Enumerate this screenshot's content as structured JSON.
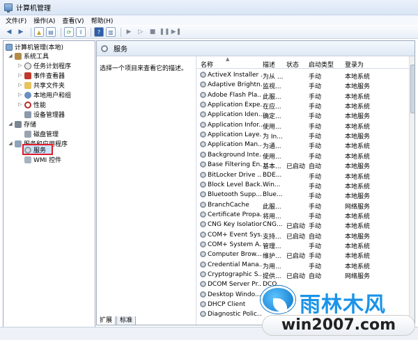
{
  "window": {
    "title": "计算机管理"
  },
  "menu": [
    "文件(F)",
    "操作(A)",
    "查看(V)",
    "帮助(H)"
  ],
  "tree": {
    "root": "计算机管理(本地)",
    "system_tools": "系统工具",
    "task_scheduler": "任务计划程序",
    "event_viewer": "事件查看器",
    "shared_folders": "共享文件夹",
    "local_users": "本地用户和组",
    "performance": "性能",
    "device_manager": "设备管理器",
    "storage": "存储",
    "disk_management": "磁盘管理",
    "services_apps": "服务和应用程序",
    "services": "服务",
    "wmi": "WMI 控件"
  },
  "panel": {
    "title": "服务",
    "hint": "选择一个项目来查看它的描述。",
    "columns": [
      "名称",
      "描述",
      "状态",
      "启动类型",
      "登录为"
    ]
  },
  "services": [
    [
      "ActiveX Installer ...",
      "为从 ...",
      "",
      "手动",
      "本地系统"
    ],
    [
      "Adaptive Brightn...",
      "监视...",
      "",
      "手动",
      "本地服务"
    ],
    [
      "Adobe Flash Pla...",
      "此服...",
      "",
      "手动",
      "本地系统"
    ],
    [
      "Application Expe...",
      "在应...",
      "",
      "手动",
      "本地系统"
    ],
    [
      "Application Iden...",
      "确定...",
      "",
      "手动",
      "本地服务"
    ],
    [
      "Application Infor...",
      "使用...",
      "",
      "手动",
      "本地系统"
    ],
    [
      "Application Laye...",
      "为 In...",
      "",
      "手动",
      "本地服务"
    ],
    [
      "Application Man...",
      "为通...",
      "",
      "手动",
      "本地系统"
    ],
    [
      "Background Inte...",
      "使用...",
      "",
      "手动",
      "本地系统"
    ],
    [
      "Base Filtering En...",
      "基本...",
      "已启动",
      "自动",
      "本地服务"
    ],
    [
      "BitLocker Drive ...",
      "BDE...",
      "",
      "手动",
      "本地系统"
    ],
    [
      "Block Level Back...",
      "Win...",
      "",
      "手动",
      "本地系统"
    ],
    [
      "Bluetooth Supp...",
      "Blue...",
      "",
      "手动",
      "本地服务"
    ],
    [
      "BranchCache",
      "此服...",
      "",
      "手动",
      "网络服务"
    ],
    [
      "Certificate Propa...",
      "将用...",
      "",
      "手动",
      "本地系统"
    ],
    [
      "CNG Key Isolation",
      "CNG...",
      "已启动",
      "手动",
      "本地系统"
    ],
    [
      "COM+ Event Sys...",
      "支持...",
      "已启动",
      "自动",
      "本地服务"
    ],
    [
      "COM+ System A...",
      "管理...",
      "",
      "手动",
      "本地系统"
    ],
    [
      "Computer Brow...",
      "维护...",
      "已启动",
      "手动",
      "本地系统"
    ],
    [
      "Credential Mana...",
      "为用...",
      "",
      "手动",
      "本地系统"
    ],
    [
      "Cryptographic S...",
      "提供...",
      "已启动",
      "自动",
      "网络服务"
    ],
    [
      "DCOM Server Pr...",
      "DCO...",
      "",
      "",
      ""
    ],
    [
      "Desktop Windo...",
      "",
      "",
      "",
      ""
    ],
    [
      "DHCP Client",
      "",
      "",
      "",
      ""
    ],
    [
      "Diagnostic Polic...",
      "",
      "",
      "",
      ""
    ]
  ],
  "tabs": [
    "扩展",
    "标准"
  ],
  "watermark": {
    "title": "雨林木风",
    "url": "win2007.com"
  }
}
